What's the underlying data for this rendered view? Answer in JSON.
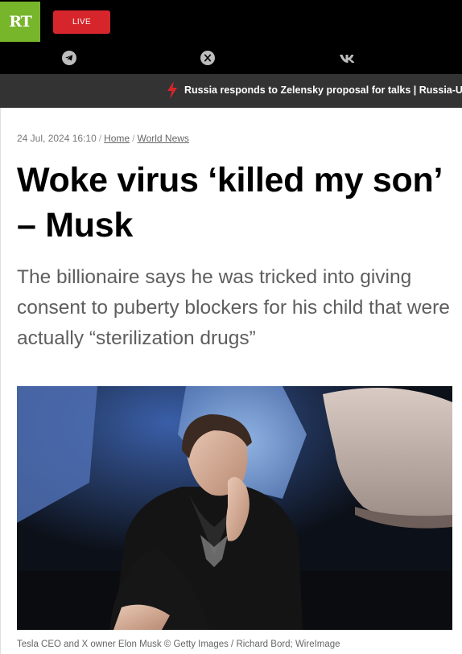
{
  "header": {
    "logo_text": "RT",
    "live_label": "LIVE",
    "social": [
      "telegram-icon",
      "x-icon",
      "vk-icon"
    ]
  },
  "ticker": {
    "text": "Russia responds to Zelensky proposal for talks | Russia-Uk"
  },
  "article": {
    "date": "24 Jul, 2024 16:10",
    "breadcrumb": [
      "Home",
      "World News"
    ],
    "title": "Woke virus ‘killed my son’ – Musk",
    "summary": "The billionaire says he was tricked into giving consent to puberty blockers for his child that were actually “sterilization drugs”",
    "image_caption": "Tesla CEO and X owner Elon Musk © Getty Images / Richard Bord;  WireImage"
  },
  "colors": {
    "logo_green": "#77b52a",
    "live_red": "#d7262b",
    "ticker_bg": "#333333",
    "bolt_red": "#d7262b"
  }
}
